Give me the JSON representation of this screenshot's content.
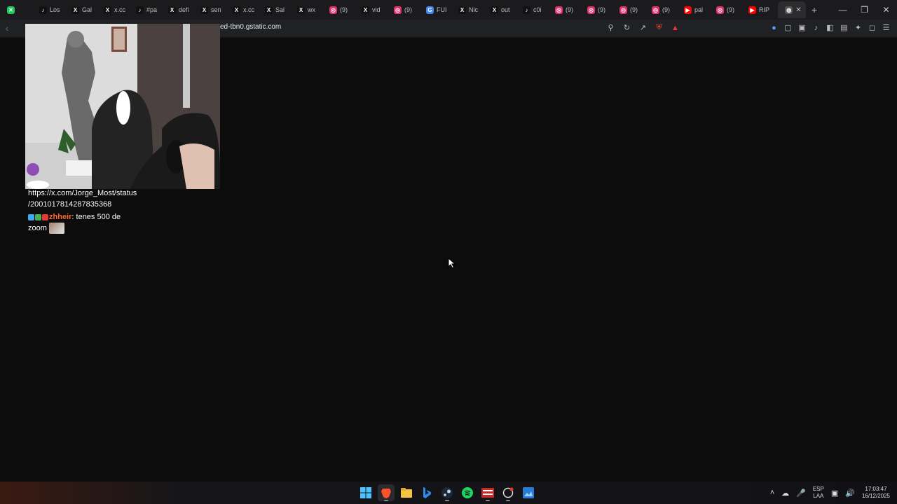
{
  "tabs": [
    {
      "icon": "muted-tab-icon",
      "label": "",
      "color": "#22c55e"
    },
    {
      "icon": "tiktok-icon",
      "label": "Los",
      "color": "#111111"
    },
    {
      "icon": "x-icon",
      "label": "Gal",
      "color": "#111111"
    },
    {
      "icon": "x-icon",
      "label": "x.cc",
      "color": "#111111"
    },
    {
      "icon": "tiktok-icon",
      "label": "#pa",
      "color": "#111111"
    },
    {
      "icon": "x-icon",
      "label": "defi",
      "color": "#111111"
    },
    {
      "icon": "x-icon",
      "label": "sen",
      "color": "#111111"
    },
    {
      "icon": "x-icon",
      "label": "x.cc",
      "color": "#111111"
    },
    {
      "icon": "x-icon",
      "label": "Sal",
      "color": "#111111"
    },
    {
      "icon": "x-icon",
      "label": "wx",
      "color": "#111111"
    },
    {
      "icon": "instagram-icon",
      "label": "(9)",
      "color": "#e1306c"
    },
    {
      "icon": "x-icon",
      "label": "vid",
      "color": "#111111"
    },
    {
      "icon": "instagram-icon",
      "label": "(9)",
      "color": "#e1306c"
    },
    {
      "icon": "google-icon",
      "label": "FUI",
      "color": "#4285f4"
    },
    {
      "icon": "x-icon",
      "label": "Nic",
      "color": "#111111"
    },
    {
      "icon": "x-icon",
      "label": "out",
      "color": "#111111"
    },
    {
      "icon": "tiktok-icon",
      "label": "c0i",
      "color": "#111111"
    },
    {
      "icon": "instagram-icon",
      "label": "(9)",
      "color": "#e1306c"
    },
    {
      "icon": "instagram-icon",
      "label": "(9)",
      "color": "#e1306c"
    },
    {
      "icon": "instagram-icon",
      "label": "(9)",
      "color": "#e1306c"
    },
    {
      "icon": "instagram-icon",
      "label": "(9)",
      "color": "#e1306c"
    },
    {
      "icon": "youtube-icon",
      "label": "pal",
      "color": "#ff0000"
    },
    {
      "icon": "instagram-icon",
      "label": "(9)",
      "color": "#e1306c"
    },
    {
      "icon": "youtube-icon",
      "label": "RIP",
      "color": "#ff0000"
    }
  ],
  "address": {
    "url": "ed-tbn0.gstatic.com"
  },
  "chat": {
    "link_line1": "https://x.com/Jorge_Most/status",
    "link_line2": "/2001017814287835368",
    "username": "zhheir",
    "message_part1": ": tenes 500 de",
    "message_part2": "zoom"
  },
  "tray": {
    "lang_top": "ESP",
    "lang_bottom": "LAA",
    "time": "17:03:47",
    "date": "16/12/2025"
  },
  "colors": {
    "tab_bar": "#1b1b1d",
    "address_bar": "#202124",
    "page_bg": "#0c0c0c",
    "username": "#ff6a2e"
  }
}
